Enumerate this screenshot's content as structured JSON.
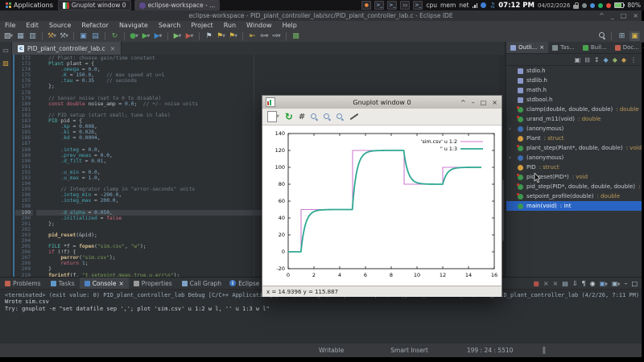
{
  "desktop": {
    "applications_label": "Applications",
    "tasks": [
      {
        "label": "Gnuplot window 0"
      },
      {
        "label": "eclipse-workspace - ..."
      }
    ],
    "tray": {
      "cpu": "cpu",
      "mem": "mem",
      "net": "net",
      "time": "07:12 PM",
      "date": "04/02/2026",
      "battery": "80%"
    }
  },
  "window": {
    "title": "eclipse-workspace - PID_plant_controller_lab/src/PID_plant_controller_lab.c - Eclipse IDE",
    "controls": [
      "^",
      "_",
      "□",
      "×"
    ]
  },
  "menubar": [
    "File",
    "Edit",
    "Source",
    "Refactor",
    "Navigate",
    "Search",
    "Project",
    "Run",
    "Window",
    "Help"
  ],
  "toolbar": [
    {
      "name": "new",
      "glyph": "▧",
      "color": "#b9c6d1",
      "caret": true
    },
    {
      "name": "save",
      "glyph": "▦",
      "color": "#9fb6c9"
    },
    {
      "name": "save-all",
      "glyph": "▥",
      "color": "#9fb6c9"
    },
    {
      "name": "sep"
    },
    {
      "name": "build",
      "glyph": "⚒",
      "color": "#c89a4e",
      "caret": true
    },
    {
      "name": "build-all",
      "glyph": "⚒",
      "color": "#98a4ae",
      "caret": true
    },
    {
      "name": "sep"
    },
    {
      "name": "new-console",
      "glyph": "▣",
      "color": "#76a3d4"
    },
    {
      "name": "terminal",
      "glyph": "▤",
      "color": "#76a3d4"
    },
    {
      "name": "sep"
    },
    {
      "name": "refresh",
      "glyph": "↻",
      "color": "#63a85e"
    },
    {
      "name": "sep"
    },
    {
      "name": "debug",
      "glyph": "●",
      "color": "#4aa24f",
      "caret": true
    },
    {
      "name": "run",
      "glyph": "▶",
      "color": "#57b457",
      "caret": true
    },
    {
      "name": "profile",
      "glyph": "▶",
      "color": "#3b87c8",
      "caret": true
    },
    {
      "name": "sep"
    },
    {
      "name": "run-config",
      "glyph": "▶",
      "color": "#7bbf6f",
      "caret": true
    },
    {
      "name": "coverage",
      "glyph": "▶",
      "color": "#c05a4e",
      "caret": true
    },
    {
      "name": "sep"
    },
    {
      "name": "toggle-mark",
      "glyph": "⚑",
      "color": "#b9c6d1"
    },
    {
      "name": "next-annotation",
      "glyph": "⚑",
      "color": "#d4b44a",
      "caret": true
    },
    {
      "name": "prev-annotation",
      "glyph": "⚑",
      "color": "#d4b44a",
      "caret": true
    },
    {
      "name": "sep"
    },
    {
      "name": "last-edit",
      "glyph": "⇤",
      "color": "#d4b44a"
    },
    {
      "name": "back",
      "glyph": "⇦",
      "color": "#c3ccd4",
      "caret": true
    },
    {
      "name": "forward",
      "glyph": "⇨",
      "color": "#c3ccd4",
      "caret": true
    },
    {
      "name": "sep"
    },
    {
      "name": "editor-image",
      "glyph": "▩",
      "color": "#6fae5c"
    }
  ],
  "toolbar_right": [
    {
      "name": "open-perspective",
      "glyph": "⊞",
      "color": "#9fb6c9"
    },
    {
      "name": "cpp-perspective",
      "glyph": "▣",
      "color": "#d4b44a"
    }
  ],
  "editor": {
    "tab": "PID_plant_controller_lab.c",
    "tab_file_letter": "c",
    "close_glyph": "×",
    "start_line": 172,
    "current_line": 199,
    "lines": [
      "    // Plant: choose gain/time constant",
      "    Plant plant = {",
      "        .omega = 0.0,",
      "        .K = 150.0,    // max speed at u=1",
      "        .tau = 0.35    // seconds",
      "    };",
      "",
      "    // Sensor noise (set to 0 to disable)",
      "    const double noise_amp = 0.0;  // +/- noise units",
      "",
      "    // PID setup (start small; tune in labs)",
      "    PID pid = {",
      "        .kp = 0.008,",
      "        .ki = 0.026,",
      "        .kd = 0.0004,",
      "",
      "        .integ = 0.0,",
      "        .prev_meas = 0.0,",
      "        .d_filt = 0.01,",
      "",
      "        .u_min = 0.0,",
      "        .u_max = 1.0,",
      "",
      "        // Integrator clamp in \"error-seconds\" units",
      "        .integ_min = -200.0,",
      "        .integ_max = 200.0,",
      "",
      "        .d_alpha = 0.050,",
      "        .initialized = false",
      "    };",
      "",
      "    pid_reset(&pid);",
      "",
      "    FILE *f = fopen(\"sim.csv\", \"w\");",
      "    if (!f) {",
      "        perror(\"sim.csv\");",
      "        return 1;",
      "    }",
      "    fprintf(f, \"t,setpoint,meas,true,u,err\\n\");"
    ]
  },
  "gnuplot": {
    "title": "Gnuplot window 0",
    "controls": [
      "^",
      "–",
      "□",
      "×"
    ],
    "grid_glyph": "#",
    "status": "x = 14.9396 y = 115.887"
  },
  "chart_data": {
    "type": "line",
    "title": "",
    "xlabel": "",
    "ylabel": "",
    "xlim": [
      0,
      16
    ],
    "ylim": [
      -20,
      140
    ],
    "xticks": [
      0,
      2,
      4,
      6,
      8,
      10,
      12,
      14,
      16
    ],
    "yticks": [
      -20,
      0,
      20,
      40,
      60,
      80,
      100,
      120,
      140
    ],
    "grid": false,
    "legend_position": "top-right",
    "series": [
      {
        "name": "'sim.csv' u 1:2",
        "color": "#cd7ad0",
        "style": "step",
        "points": [
          [
            0,
            0
          ],
          [
            1,
            0
          ],
          [
            1,
            50
          ],
          [
            5,
            50
          ],
          [
            5,
            120
          ],
          [
            9,
            120
          ],
          [
            9,
            80
          ],
          [
            12,
            80
          ],
          [
            12,
            100
          ],
          [
            15,
            100
          ]
        ]
      },
      {
        "name": "'' u 1:3",
        "color": "#2fa893",
        "style": "line",
        "model": {
          "type": "first_order_tracking",
          "tau": 0.35,
          "t_end": 15,
          "dt": 0.03
        },
        "points": [
          [
            0,
            0
          ],
          [
            0.5,
            0
          ],
          [
            1,
            0
          ],
          [
            1.5,
            38.0
          ],
          [
            2,
            47.1
          ],
          [
            2.5,
            49.3
          ],
          [
            3,
            49.8
          ],
          [
            3.5,
            50
          ],
          [
            4,
            50
          ],
          [
            4.5,
            50
          ],
          [
            5,
            50
          ],
          [
            5.5,
            103.2
          ],
          [
            6,
            116.0
          ],
          [
            6.5,
            119.0
          ],
          [
            7,
            119.8
          ],
          [
            7.5,
            119.9
          ],
          [
            8,
            120
          ],
          [
            8.5,
            120
          ],
          [
            9,
            120
          ],
          [
            9.5,
            89.6
          ],
          [
            10,
            82.3
          ],
          [
            10.5,
            80.6
          ],
          [
            11,
            80.1
          ],
          [
            11.5,
            80
          ],
          [
            12,
            80
          ],
          [
            12.5,
            95.2
          ],
          [
            13,
            98.9
          ],
          [
            13.5,
            99.7
          ],
          [
            14,
            99.9
          ],
          [
            14.5,
            100
          ],
          [
            15,
            100
          ]
        ]
      }
    ]
  },
  "outline": {
    "tabs": [
      {
        "label": "Outli...",
        "active": true,
        "close": "×",
        "color": "#8f9fd0"
      },
      {
        "label": "Tas...",
        "active": false,
        "color": "#7f8c8d"
      },
      {
        "label": "Buil...",
        "active": false,
        "color": "#4aa24f"
      },
      {
        "label": "Doc...",
        "active": false,
        "color": "#c0604e"
      }
    ],
    "tools": [
      {
        "name": "link-editor",
        "glyph": "▣"
      },
      {
        "name": "collapse-all",
        "glyph": "⊟"
      },
      {
        "name": "sort",
        "glyph": "↕"
      },
      {
        "name": "hide-fields",
        "glyph": "◆",
        "color": "#6fa3c9"
      },
      {
        "name": "hide-static",
        "glyph": "◆",
        "color": "#8fae67"
      },
      {
        "name": "hide-non-public",
        "glyph": "◆",
        "color": "#c79a50"
      },
      {
        "name": "view-menu",
        "glyph": "⋮"
      }
    ],
    "items": [
      {
        "label": "stdio.h",
        "type": "",
        "icon": "inc"
      },
      {
        "label": "stdlib.h",
        "type": "",
        "icon": "inc"
      },
      {
        "label": "math.h",
        "type": "",
        "icon": "inc"
      },
      {
        "label": "stdbool.h",
        "type": "",
        "icon": "inc"
      },
      {
        "label": "clamp(double, double, double)",
        "type": " : double",
        "icon": "func"
      },
      {
        "label": "urand_m11(void)",
        "type": " : double",
        "icon": "func"
      },
      {
        "label": "(anonymous)",
        "type": "",
        "icon": "anon",
        "chevron": true
      },
      {
        "label": "Plant",
        "type": " : struct",
        "icon": "struct"
      },
      {
        "label": "plant_step(Plant*, double, double)",
        "type": " : void",
        "icon": "func"
      },
      {
        "label": "(anonymous)",
        "type": "",
        "icon": "anon",
        "chevron": true
      },
      {
        "label": "PID",
        "type": " : struct",
        "icon": "struct"
      },
      {
        "label": "pid_reset(PID*)",
        "type": " : void",
        "icon": "func"
      },
      {
        "label": "pid_step(PID*, double, double, double)",
        "type": " : double",
        "icon": "func"
      },
      {
        "label": "setpoint_profile(double)",
        "type": " : double",
        "icon": "func"
      },
      {
        "label": "main(void)",
        "type": " : int",
        "icon": "mainf",
        "selected": true
      }
    ]
  },
  "bottom": {
    "tabs": [
      {
        "label": "Problems",
        "color": "#c0604e"
      },
      {
        "label": "Tasks",
        "color": "#5f99c7"
      },
      {
        "label": "Console",
        "color": "#4f83c4",
        "active": true,
        "close": "×"
      },
      {
        "label": "Properties",
        "color": "#9a9a9a"
      },
      {
        "label": "Call Graph",
        "color": "#7fa2c4"
      }
    ],
    "brand": "Eclipse IDE for Embedded C/C++ Developers 2026-03 Release",
    "tools": [
      {
        "name": "terminate",
        "glyph": "■",
        "color": "#b0524a"
      },
      {
        "name": "remove-launch",
        "glyph": "×",
        "color": "#9a9a9a"
      },
      {
        "name": "remove-all-launches",
        "glyph": "×",
        "color": "#9a9a9a"
      },
      {
        "name": "clear-console",
        "glyph": "▤",
        "color": "#9fb6c9"
      },
      {
        "name": "scroll-lock",
        "glyph": "⇩",
        "color": "#c3ccd4"
      },
      {
        "name": "word-wrap",
        "glyph": "¶",
        "color": "#c3ccd4"
      },
      {
        "name": "pin-console",
        "glyph": "◉",
        "color": "#c3ccd4"
      },
      {
        "name": "show-stdout",
        "glyph": "▣",
        "color": "#76a3d4",
        "caret": true
      },
      {
        "name": "open-console",
        "glyph": "▣",
        "color": "#9fb6c9",
        "caret": true
      },
      {
        "name": "minimize",
        "glyph": "–",
        "color": "#c3ccd4"
      },
      {
        "name": "maximize",
        "glyph": "□",
        "color": "#c3ccd4"
      }
    ],
    "console_header": "<terminated> (exit value: 0) PID_plant_controller_lab Debug [C/C++ Application] /home/hamburger/eclipse-workspace/PID_plant_controller_lab/Debug/PID_plant_controller_lab (4/2/26, 7:11 PM)",
    "console_lines": [
      "Wrote sim.csv",
      "Try: gnuplot -e \"set datafile sep ','; plot 'sim.csv' u 1:2 w l, '' u 1:3 w l\""
    ]
  },
  "statusbar": {
    "writable": "Writable",
    "insert_mode": "Smart Insert",
    "position": "199 : 24 : 5510"
  }
}
